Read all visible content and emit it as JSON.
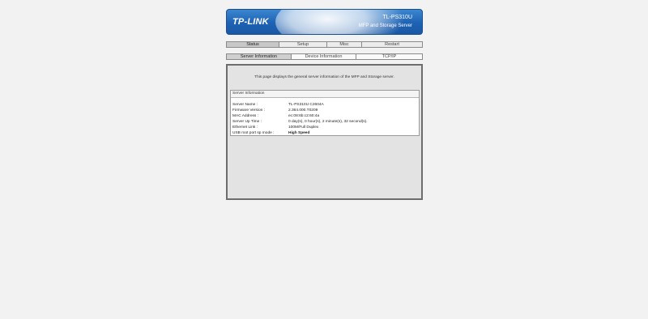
{
  "header": {
    "logo": "TP-LINK",
    "model": "TL-PS310U",
    "description": "MFP and Storage Server"
  },
  "nav": {
    "main": [
      "Status",
      "Setup",
      "Misc",
      "Restart"
    ],
    "sub": [
      "Server Information",
      "Device Information",
      "TCP/IP"
    ]
  },
  "content": {
    "intro": "This page displays the general server information of the MFP and Storage server.",
    "section_title": "Server Information",
    "rows": [
      {
        "label": "Server Name :",
        "value": "TL-PS310U C2604A"
      },
      {
        "label": "Firmware Version :",
        "value": "2.364.000.T0209"
      },
      {
        "label": "MAC Address :",
        "value": "ec:08:6b:c2:60:4a"
      },
      {
        "label": "Server Up Time :",
        "value": "0 day(s), 0 hour(s), 2 minute(s), 32 second(s)."
      },
      {
        "label": "Ethernet Link :",
        "value": "100M/Full Duplex"
      },
      {
        "label": "USB root port sp mode :",
        "value": "High Speed"
      }
    ]
  }
}
